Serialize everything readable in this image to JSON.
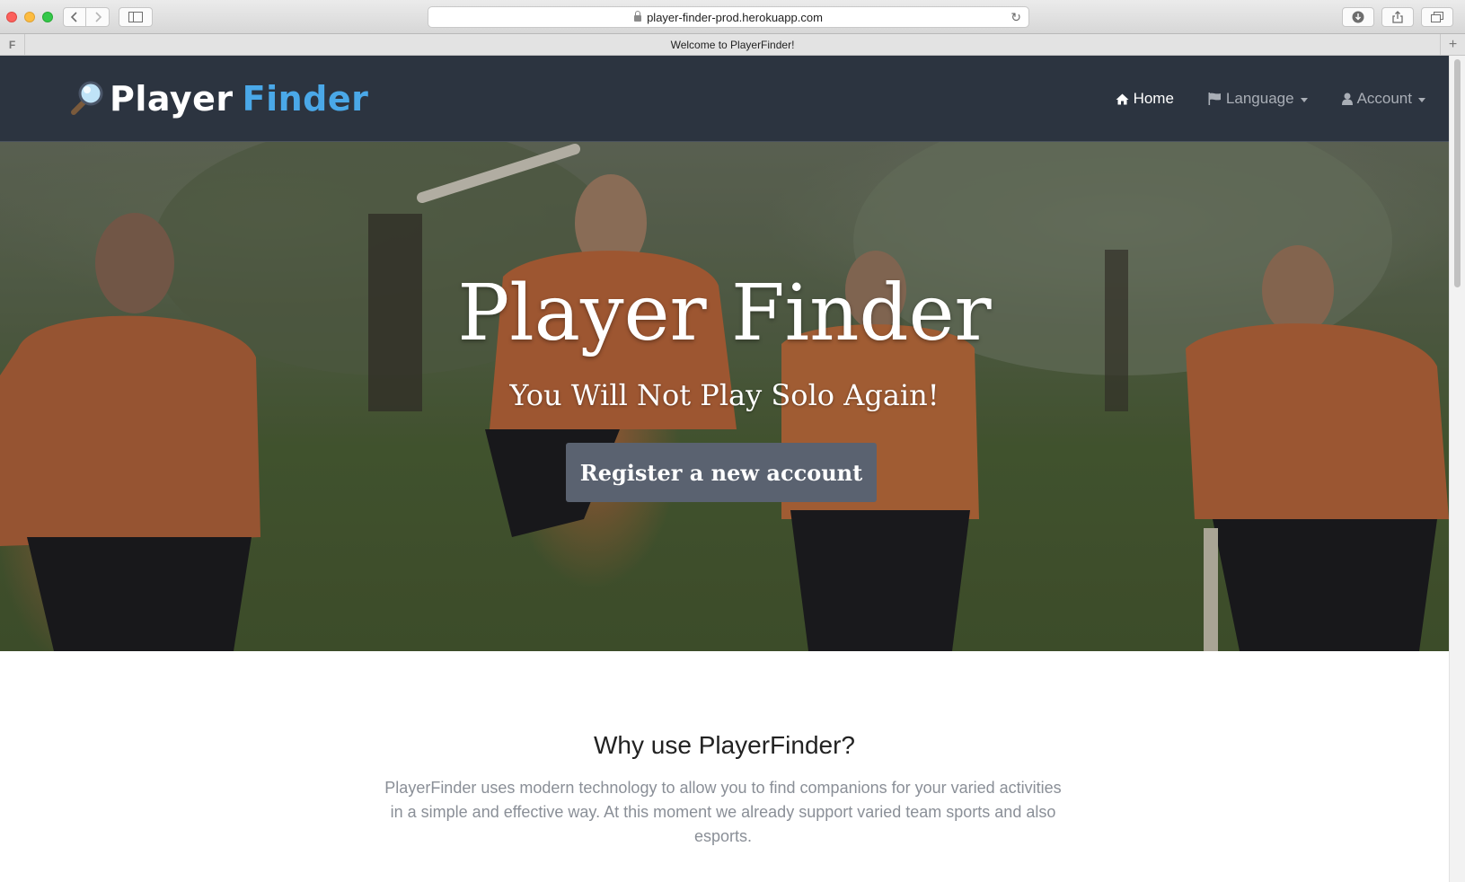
{
  "browser": {
    "url": "player-finder-prod.herokuapp.com",
    "tab_title": "Welcome to PlayerFinder!",
    "favicon_letter": "F",
    "new_tab": "+"
  },
  "navbar": {
    "logo_player": "Player",
    "logo_finder": "Finder",
    "links": [
      {
        "label": "Home",
        "icon": "home-icon",
        "active": true
      },
      {
        "label": "Language",
        "icon": "flag-icon",
        "dropdown": true
      },
      {
        "label": "Account",
        "icon": "user-icon",
        "dropdown": true
      }
    ]
  },
  "hero": {
    "title": "Player Finder",
    "subtitle": "You Will Not Play Solo Again!",
    "register_button": "Register a new account"
  },
  "why": {
    "title": "Why use PlayerFinder?",
    "text": "PlayerFinder uses modern technology to allow you to find companions for your varied activities in a simple and effective way. At this moment we already support varied team sports and also esports."
  },
  "colors": {
    "navbar_bg": "#2c3440",
    "brand_blue": "#4aa8e8",
    "hero_button": "#5a6270"
  }
}
